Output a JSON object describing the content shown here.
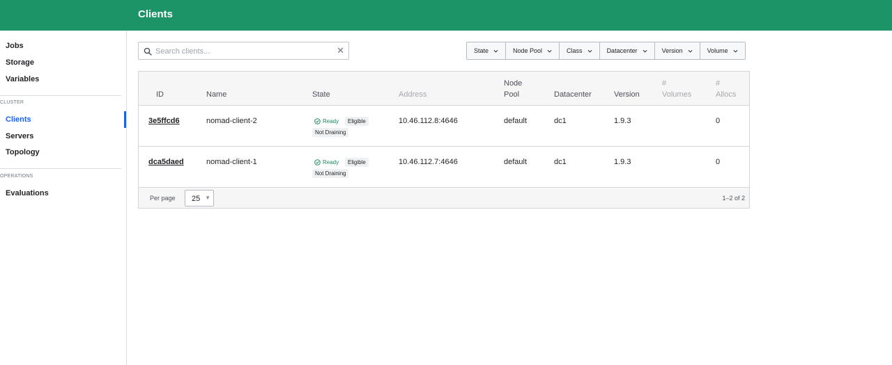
{
  "header": {
    "title": "Clients"
  },
  "sidebar": {
    "items": [
      {
        "label": "Jobs"
      },
      {
        "label": "Storage"
      },
      {
        "label": "Variables"
      }
    ],
    "sections": [
      {
        "label": "CLUSTER",
        "items": [
          {
            "label": "Clients",
            "active": true
          },
          {
            "label": "Servers"
          },
          {
            "label": "Topology"
          }
        ]
      },
      {
        "label": "OPERATIONS",
        "items": [
          {
            "label": "Evaluations"
          }
        ]
      }
    ]
  },
  "search": {
    "placeholder": "Search clients..."
  },
  "filters": [
    "State",
    "Node Pool",
    "Class",
    "Datacenter",
    "Version",
    "Volume"
  ],
  "table": {
    "columns": {
      "id": "ID",
      "name": "Name",
      "state": "State",
      "address": "Address",
      "node_pool_1": "Node",
      "node_pool_2": "Pool",
      "datacenter": "Datacenter",
      "version": "Version",
      "volumes_1": "#",
      "volumes_2": "Volumes",
      "allocs_1": "#",
      "allocs_2": "Allocs"
    },
    "rows": [
      {
        "id": "3e5ffcd6",
        "name": "nomad-client-2",
        "status": "Ready",
        "eligibility": "Eligible",
        "drain": "Not Draining",
        "address": "10.46.112.8:4646",
        "node_pool": "default",
        "datacenter": "dc1",
        "version": "1.9.3",
        "allocs": "0"
      },
      {
        "id": "dca5daed",
        "name": "nomad-client-1",
        "status": "Ready",
        "eligibility": "Eligible",
        "drain": "Not Draining",
        "address": "10.46.112.7:4646",
        "node_pool": "default",
        "datacenter": "dc1",
        "version": "1.9.3",
        "allocs": "0"
      }
    ]
  },
  "pagination": {
    "per_page_label": "Per page",
    "per_page_value": "25",
    "range": "1–2 of 2"
  },
  "colors": {
    "header": "#1d9467",
    "active_nav": "#1563ff",
    "ready": "#1a8a5a"
  }
}
